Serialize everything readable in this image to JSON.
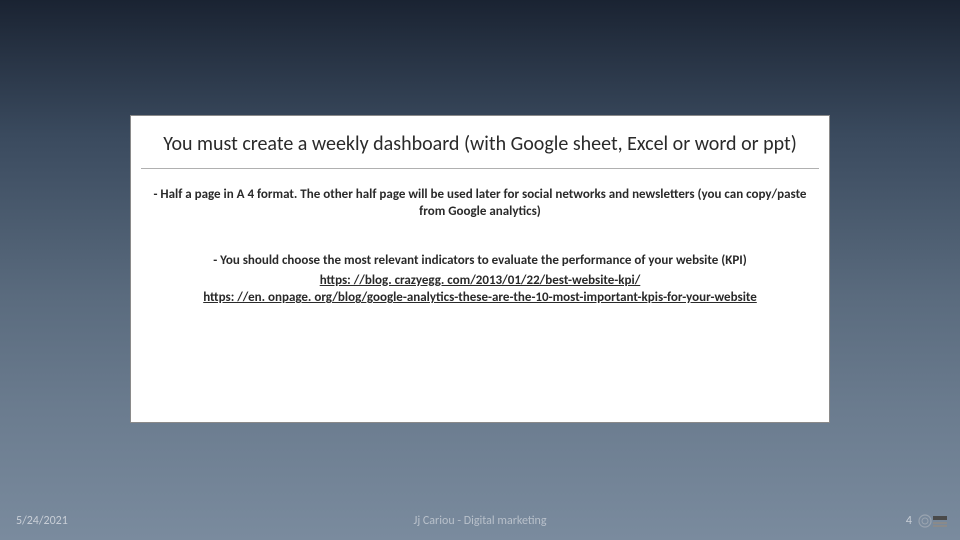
{
  "content": {
    "title": "You must create a weekly dashboard (with Google sheet, Excel or word or ppt)",
    "para1": "- Half a page in A 4 format. The other half page will be used later for social networks and newsletters (you can copy/paste from Google analytics)",
    "para2": "- You should choose the most relevant indicators to evaluate the performance of your website (KPI)",
    "link1": "https: //blog. crazyegg. com/2013/01/22/best-website-kpi/",
    "link2": "https: //en. onpage. org/blog/google-analytics-these-are-the-10-most-important-kpis-for-your-website"
  },
  "footer": {
    "date": "5/24/2021",
    "center": "Jj Cariou - Digital marketing",
    "page": "4"
  }
}
